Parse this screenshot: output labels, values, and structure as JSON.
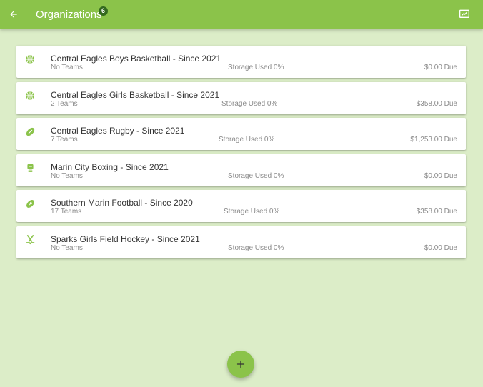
{
  "header": {
    "title": "Organizations",
    "badge_count": "6",
    "back_icon": "arrow-left-icon",
    "action_icon": "feedback-icon"
  },
  "colors": {
    "primary": "#8bc34a",
    "background": "#dcedc8",
    "badge": "#33691e",
    "icon": "#8bc34a"
  },
  "organizations": [
    {
      "name": "Central Eagles Boys Basketball - Since 2021",
      "teams": "No Teams",
      "storage": "Storage Used 0%",
      "due": "$0.00 Due",
      "icon": "basketball-icon"
    },
    {
      "name": "Central Eagles Girls Basketball - Since 2021",
      "teams": "2 Teams",
      "storage": "Storage Used 0%",
      "due": "$358.00 Due",
      "icon": "basketball-icon"
    },
    {
      "name": "Central Eagles Rugby - Since 2021",
      "teams": "7 Teams",
      "storage": "Storage Used 0%",
      "due": "$1,253.00 Due",
      "icon": "rugby-ball-icon"
    },
    {
      "name": "Marin City Boxing - Since 2021",
      "teams": "No Teams",
      "storage": "Storage Used 0%",
      "due": "$0.00 Due",
      "icon": "boxing-glove-icon"
    },
    {
      "name": "Southern Marin Football - Since 2020",
      "teams": "17 Teams",
      "storage": "Storage Used 0%",
      "due": "$358.00 Due",
      "icon": "football-icon"
    },
    {
      "name": "Sparks Girls Field Hockey - Since 2021",
      "teams": "No Teams",
      "storage": "Storage Used 0%",
      "due": "$0.00 Due",
      "icon": "field-hockey-icon"
    }
  ],
  "fab": {
    "label": "+",
    "icon": "plus-icon"
  }
}
